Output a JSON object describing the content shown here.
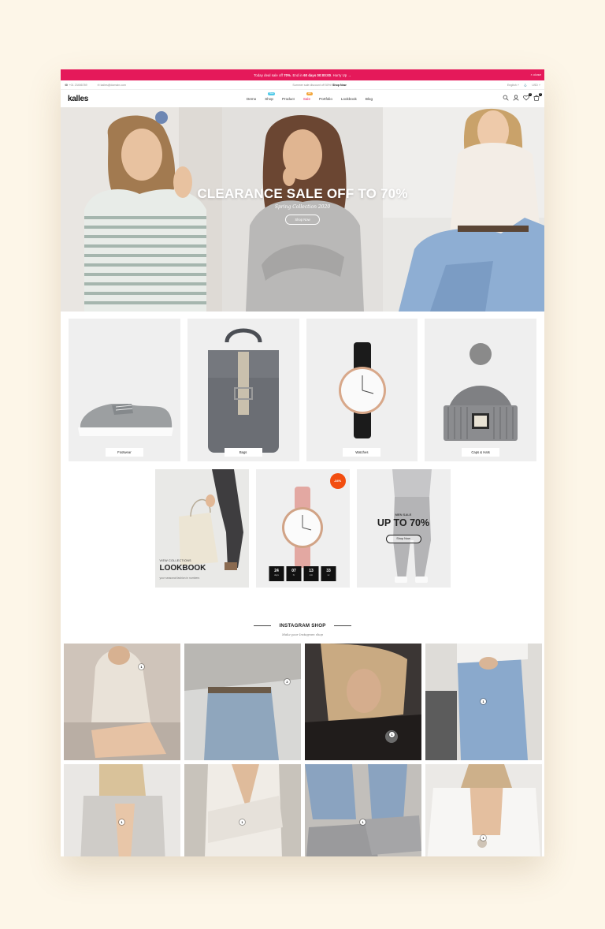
{
  "promo": {
    "prefix": "Today deal sale off ",
    "pct": "70%",
    "mid": ". End in ",
    "timer": "60 days 00:00:00",
    "suffix": ". Hurry Up →",
    "close": "× close"
  },
  "topbar": {
    "phone": "+01 23456789",
    "email": "kalles@domain.com",
    "notice": "Summer sale discount off 50%!",
    "notice_link": "Shop Now",
    "lang": "English ˅",
    "currency": "USD ˅"
  },
  "header": {
    "logo": "kalles",
    "nav": [
      {
        "label": "Demo"
      },
      {
        "label": "Shop",
        "badge": "New",
        "badge_color": "#4ec9e8"
      },
      {
        "label": "Product"
      },
      {
        "label": "Sale",
        "badge": "Hot",
        "badge_color": "#f3a63b",
        "color": "#e5195a"
      },
      {
        "label": "Portfolio"
      },
      {
        "label": "Lookbook"
      },
      {
        "label": "Blog"
      }
    ],
    "wishlist_count": "0",
    "cart_count": "0"
  },
  "hero": {
    "title": "CLEARANCE SALE OFF TO 70%",
    "subtitle": "Spring Collection 2020",
    "button": "Shop Now"
  },
  "categories": [
    {
      "label": "Footwear"
    },
    {
      "label": "Bags"
    },
    {
      "label": "Watches"
    },
    {
      "label": "Caps & Hats"
    }
  ],
  "lookbook": {
    "kicker": "VIEW COLLECTIONS",
    "title": "LOOKBOOK",
    "sub": "your seasonal fashion in numbers"
  },
  "deal": {
    "badge": "-34%",
    "countdown": [
      {
        "n": "24",
        "t": "days"
      },
      {
        "n": "07",
        "t": "hr"
      },
      {
        "n": "13",
        "t": "min"
      },
      {
        "n": "33",
        "t": "sc"
      }
    ]
  },
  "men": {
    "kicker": "MEN SALE",
    "title": "UP TO 70%",
    "button": "Shop Now"
  },
  "instagram": {
    "title": "INSTAGRAM SHOP",
    "subtitle": "Make your Instagram shop",
    "hotspots": [
      "1",
      "2",
      "1",
      "1",
      "1",
      "1",
      "1",
      "1"
    ]
  },
  "colors": {
    "accent": "#e5195a",
    "sale_badge": "#f24d0f"
  }
}
